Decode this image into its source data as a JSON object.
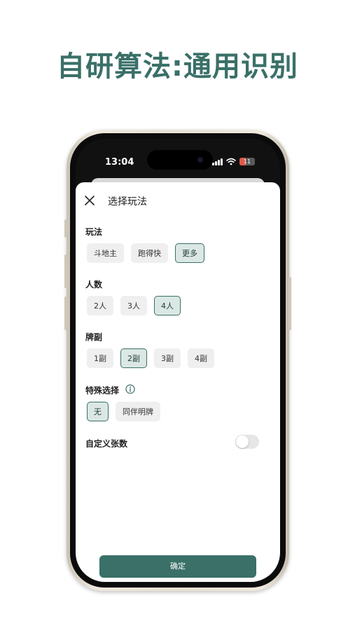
{
  "headline": "自研算法:通用识别",
  "status_bar": {
    "time": "13:04",
    "battery": "11",
    "battery_color": "#e05a4a"
  },
  "sheet": {
    "title": "选择玩法",
    "close_icon": "close-icon",
    "sections": {
      "game_mode": {
        "label": "玩法",
        "options": [
          "斗地主",
          "跑得快",
          "更多"
        ],
        "selected": "更多"
      },
      "players": {
        "label": "人数",
        "options": [
          "2人",
          "3人",
          "4人"
        ],
        "selected": "4人"
      },
      "decks": {
        "label": "牌副",
        "options": [
          "1副",
          "2副",
          "3副",
          "4副"
        ],
        "selected": "2副"
      },
      "special": {
        "label": "特殊选择",
        "info_icon": "info-icon",
        "options": [
          "无",
          "同伴明牌"
        ],
        "selected": "无"
      },
      "custom_count": {
        "label": "自定义张数",
        "toggle_on": false
      }
    },
    "confirm_label": "确定"
  },
  "colors": {
    "accent": "#3a7068",
    "chip_bg": "#efefef",
    "chip_selected_bg": "#dbe7e4"
  }
}
